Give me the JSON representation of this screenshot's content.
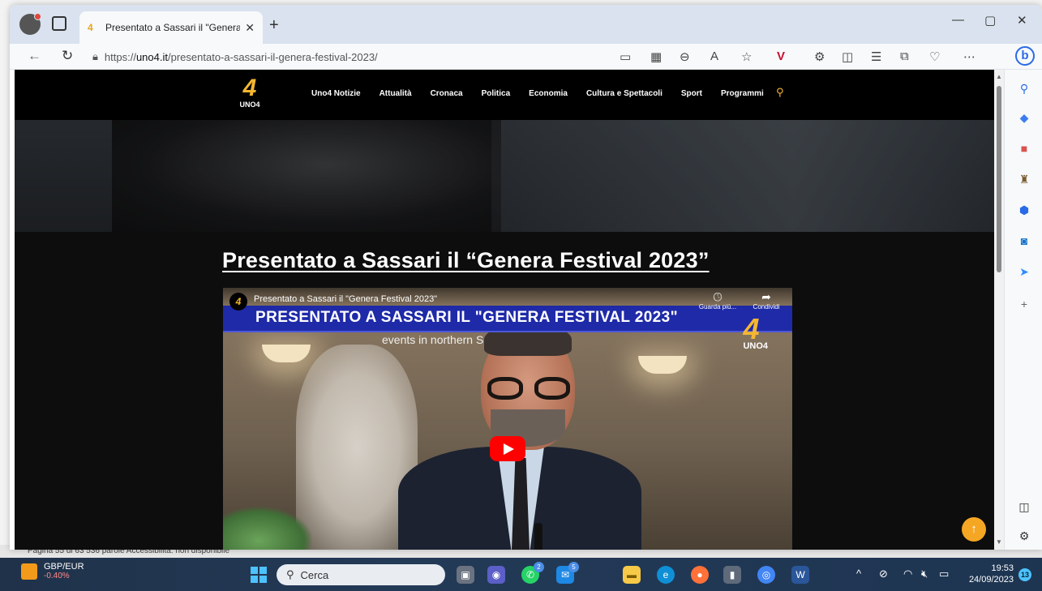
{
  "browser": {
    "tab_title": "Presentato a Sassari il \"Genera Fe",
    "tab_close": "✕",
    "new_tab": "+",
    "url_prefix": "https://",
    "url_domain": "uno4.it",
    "url_path": "/presentato-a-sassari-il-genera-festival-2023/",
    "win_minimize": "—",
    "win_maximize": "▢",
    "win_close": "✕"
  },
  "site": {
    "logo_mark": "4",
    "logo_text": "UNO4",
    "menu": [
      "Uno4 Notizie",
      "Attualità",
      "Cronaca",
      "Politica",
      "Economia",
      "Cultura e Spettacoli",
      "Sport",
      "Programmi"
    ],
    "article_title": "Presentato a Sassari il “Genera Festival 2023”"
  },
  "video": {
    "channel_mark": "4",
    "title": "Presentato a Sassari il \"Genera Festival 2023\"",
    "banner": "PRESENTATO A SASSARI IL \"GENERA FESTIVAL 2023\"",
    "subtitle": "events in northern S",
    "watch_later": "Guarda più...",
    "share": "Condividi",
    "logo_mark": "4",
    "logo_text": "UNO4"
  },
  "background_app": {
    "status_text": "Pagina 55 di 63     536 parole     Accessibilità: non disponibile"
  },
  "taskbar": {
    "ticker_symbol": "GBP/EUR",
    "ticker_change": "-0.40%",
    "search_placeholder": "Cerca",
    "whatsapp_badge": "2",
    "mail_badge": "5",
    "time": "19:53",
    "date": "24/09/2023",
    "notifications": "13"
  },
  "colors": {
    "accent": "#f5b731",
    "play_red": "#ff0000",
    "banner_blue": "#1f2aa8"
  }
}
